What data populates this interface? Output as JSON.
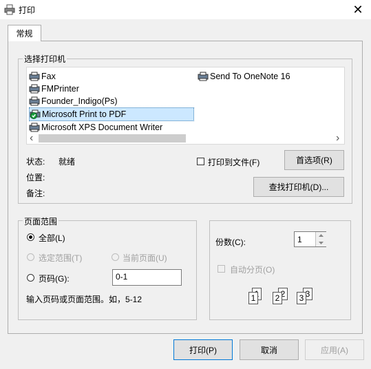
{
  "window": {
    "title": "打印",
    "close_glyph": "✕"
  },
  "tabs": [
    {
      "label": "常规"
    }
  ],
  "select_printer": {
    "legend": "选择打印机",
    "printers": [
      {
        "name": "Fax"
      },
      {
        "name": "FMPrinter"
      },
      {
        "name": "Founder_Indigo(Ps)"
      },
      {
        "name": "Microsoft Print to PDF",
        "selected": true,
        "default": true
      },
      {
        "name": "Microsoft XPS Document Writer"
      },
      {
        "name": "Send To OneNote 16"
      }
    ],
    "scroll_left": "‹",
    "scroll_right": "›",
    "status_label": "状态:",
    "status_value": "就绪",
    "location_label": "位置:",
    "comment_label": "备注:",
    "print_to_file_label": "打印到文件(F)",
    "preferences_button": "首选项(R)",
    "find_printer_button": "查找打印机(D)..."
  },
  "page_range": {
    "legend": "页面范围",
    "all_label": "全部(L)",
    "selection_label": "选定范围(T)",
    "current_page_label": "当前页面(U)",
    "pages_label": "页码(G):",
    "pages_value": "0-1",
    "hint": "输入页码或页面范围。如，5-12"
  },
  "copies": {
    "label": "份数(C):",
    "value": "1",
    "collate_label": "自动分页(O)",
    "collate_pages": [
      "1",
      "1",
      "2",
      "2",
      "3",
      "3"
    ]
  },
  "buttons": {
    "print": "打印(P)",
    "cancel": "取消",
    "apply": "应用(A)"
  },
  "colors": {
    "selection_bg": "#cce8ff",
    "focus_border": "#0078d7",
    "disabled_text": "#a0a0a0"
  }
}
